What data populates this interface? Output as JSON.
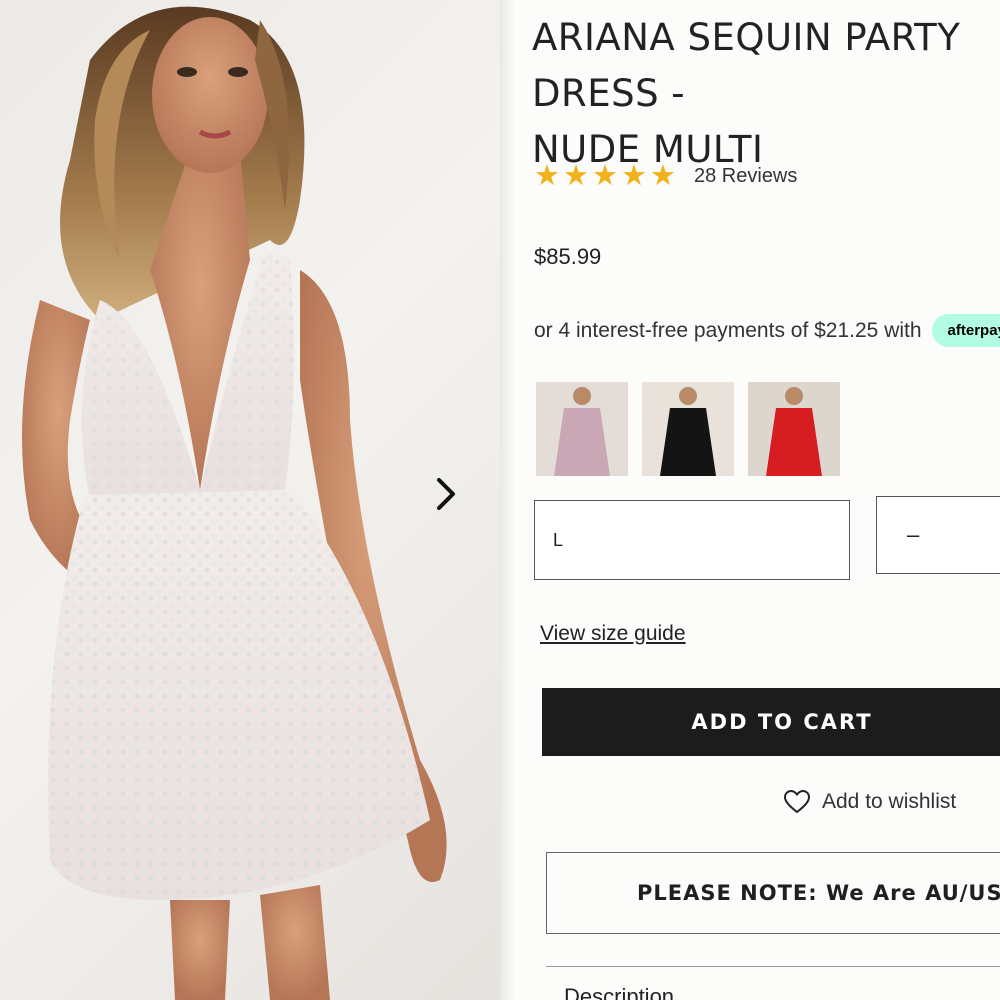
{
  "product": {
    "title": "ARIANA SEQUIN PARTY DRESS -\nNUDE MULTI",
    "rating_stars": 5,
    "reviews_label": "28 Reviews",
    "price": "$85.99",
    "payments_text": "or 4 interest-free payments of $21.25 with",
    "afterpay_label": "afterpay"
  },
  "thumbnails": [
    {
      "name": "nude-multi-thumbnail",
      "dress_color": "#c9a7b5"
    },
    {
      "name": "black-thumbnail",
      "dress_color": "#141414"
    },
    {
      "name": "red-thumbnail",
      "dress_color": "#d61d22"
    }
  ],
  "options": {
    "size_value": "L",
    "qty_minus": "–"
  },
  "links": {
    "size_guide": "View size guide"
  },
  "actions": {
    "add_to_cart": "ADD TO CART",
    "wishlist": "Add to wishlist"
  },
  "notice": {
    "text": "PLEASE NOTE: We Are AU/US BASED"
  },
  "sections": {
    "description": "Description"
  },
  "colors": {
    "star": "#f2b21b",
    "cart_button": "#1c1c1c",
    "afterpay_badge": "#b2fce4"
  }
}
